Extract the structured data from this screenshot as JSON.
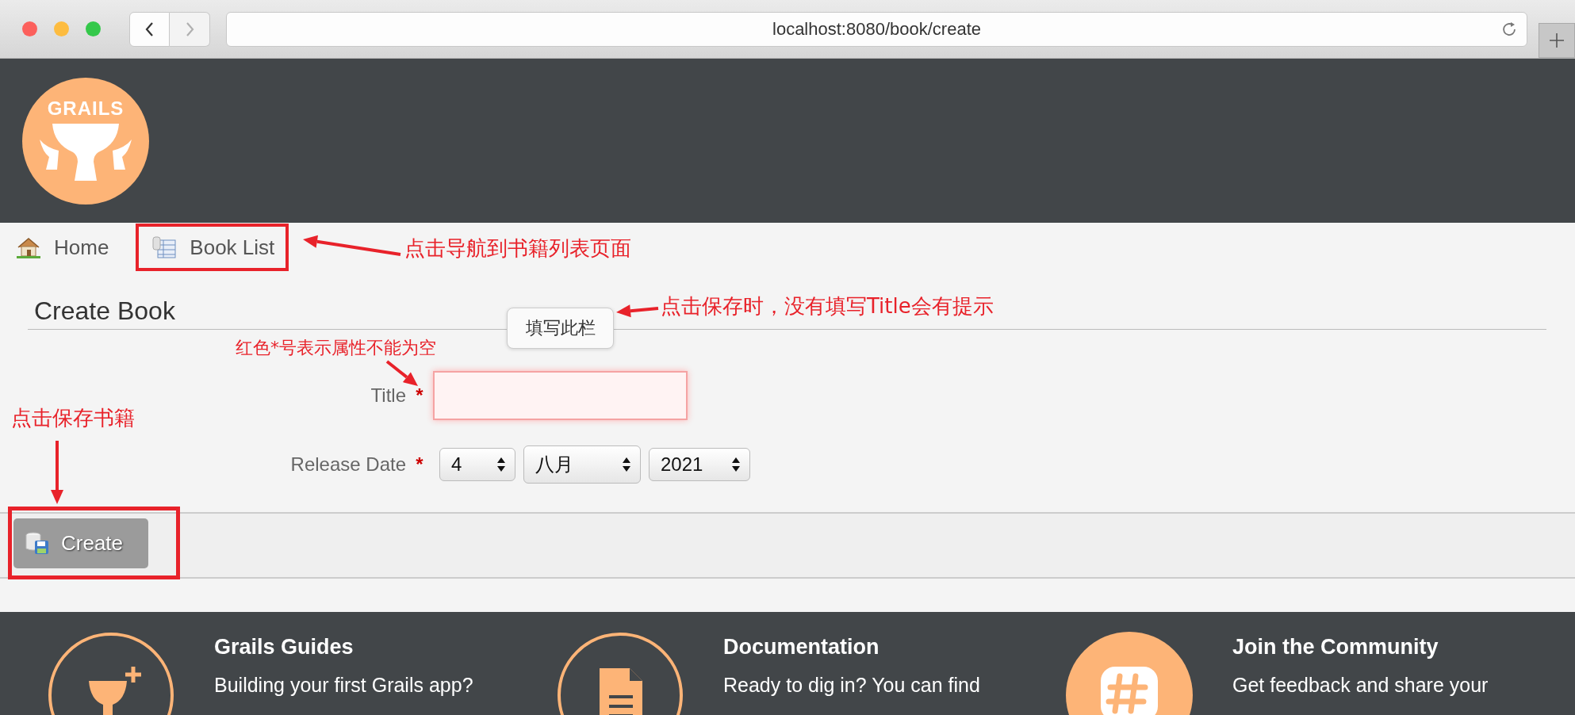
{
  "browser": {
    "url": "localhost:8080/book/create",
    "nav_buttons": [
      {
        "kind": "back",
        "disabled": false
      },
      {
        "kind": "forward",
        "disabled": true
      }
    ]
  },
  "header": {
    "logo": "GRAILS"
  },
  "nav": [
    {
      "label": "Home",
      "kind": "home",
      "highlighted": false
    },
    {
      "label": "Book List",
      "kind": "list",
      "highlighted": true
    }
  ],
  "form": {
    "title": "Create Book",
    "fields": [
      {
        "kind": "text",
        "label": "Title",
        "required_mark": "*",
        "invalid": true,
        "tooltip": "填写此栏"
      },
      {
        "kind": "date",
        "label": "Release Date",
        "required_mark": "*",
        "selects": [
          "4",
          "八月",
          "2021"
        ]
      }
    ]
  },
  "buttons": [
    {
      "label": "Create",
      "highlighted": true
    }
  ],
  "footer": [
    {
      "kind": "guide",
      "title": "Grails Guides",
      "text": "Building your first Grails app?"
    },
    {
      "kind": "doc",
      "title": "Documentation",
      "text": "Ready to dig in? You can find"
    },
    {
      "kind": "chat",
      "title": "Join the Community",
      "text": "Get feedback and share your"
    }
  ],
  "annotations": [
    {
      "text": "点击导航到书籍列表页面"
    },
    {
      "text": "点击保存时，没有填写Title会有提示"
    },
    {
      "text": "红色*号表示属性不能为空"
    },
    {
      "text": "点击保存书籍"
    }
  ]
}
